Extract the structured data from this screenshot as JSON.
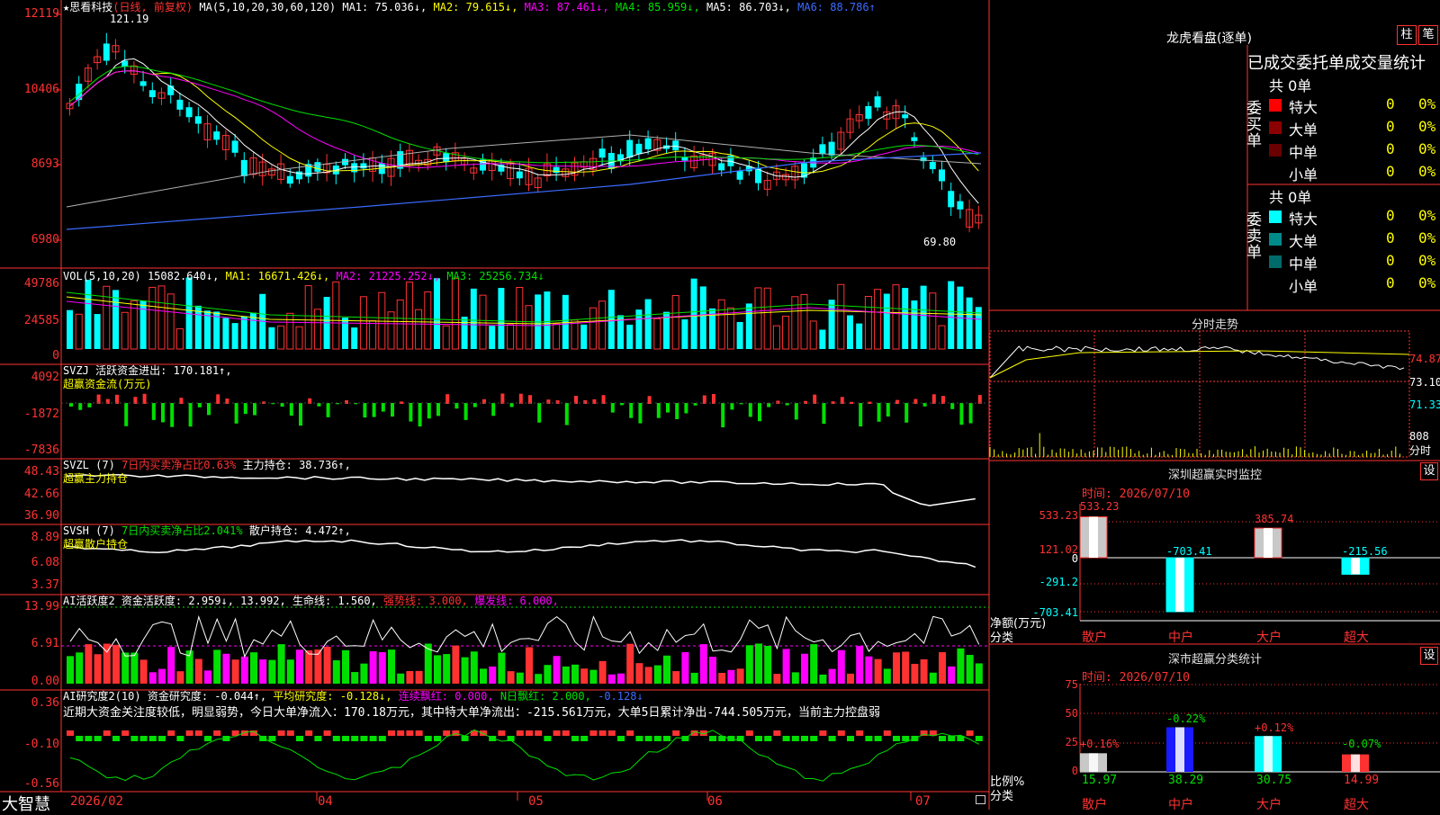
{
  "main_header": {
    "star": "★",
    "stock_name": "思看科技",
    "period": "(日线, 前复权)",
    "ma_label": "MA(5,10,20,30,60,120)",
    "ma1": "MA1: 75.036↓,",
    "ma2": "MA2: 79.615↓,",
    "ma3": "MA3: 87.461↓,",
    "ma4": "MA4: 85.959↓,",
    "ma5": "MA5: 86.703↓,",
    "ma6": "MA6: 88.786↑"
  },
  "price_axis": [
    "12119",
    "10406",
    "8693",
    "6980"
  ],
  "price_annotations": {
    "high": "121.19",
    "low": "69.80"
  },
  "vol_header": {
    "label": "VOL(5,10,20)",
    "value": "15082.640↓,",
    "ma1": "MA1: 16671.426↓,",
    "ma2": "MA2: 21225.252↓,",
    "ma3": "MA3: 25256.734↓"
  },
  "vol_axis": [
    "49786",
    "24585",
    "0"
  ],
  "svzj_header": {
    "label": "SVZJ",
    "text": "活跃资金进出: 170.181↑,",
    "subtitle": "超赢资金流(万元)"
  },
  "svzj_axis": [
    "4092",
    "-1872",
    "-7836"
  ],
  "svzl_header": {
    "label": "SVZL (7)",
    "ratio": "7日内买卖净占比0.63%",
    "text": "主力持仓: 38.736↑,",
    "subtitle": "超赢主力持仓"
  },
  "svzl_axis": [
    "48.43",
    "42.66",
    "36.90"
  ],
  "svsh_header": {
    "label": "SVSH (7)",
    "ratio": "7日内买卖净占比2.041%",
    "text": "散户持仓: 4.472↑,",
    "subtitle": "超赢散户持仓"
  },
  "svsh_axis": [
    "8.89",
    "6.08",
    "3.37"
  ],
  "ai1_header": {
    "label": "AI活跃度2",
    "text": "资金活跃度: 2.959↓, 13.992,",
    "life": "生命线: 1.560,",
    "strong": "强势线: 3.000,",
    "burst": "爆发线: 6.000,"
  },
  "ai1_axis": [
    "13.99",
    "6.91",
    "0.00"
  ],
  "ai2_header": {
    "label": "AI研究度2(10)",
    "text": "资金研究度: -0.044↑,",
    "avg": "平均研究度: -0.128↓,",
    "red": "连续飘红: 0.000,",
    "nred": "N日飘红: 2.000,",
    "blue": "-0.128↓",
    "comment": "近期大资金关注度较低，明显弱势，今日大单净流入：170.18万元，其中特大单净流出：-215.561万元，大单5日累计净出-744.505万元，当前主力控盘弱"
  },
  "ai2_axis": [
    "0.36",
    "-0.10",
    "-0.56"
  ],
  "date_axis": {
    "brand": "大智慧",
    "labels": [
      "2026/02",
      "04",
      "05",
      "06",
      "07"
    ]
  },
  "right_panel": {
    "lhb_title": "龙虎看盘(逐单)",
    "tab1": "柱",
    "tab2": "笔",
    "stats_title": "已成交委托单成交量统计",
    "buy_label": "委买单",
    "sell_label": "委卖单",
    "buy_total": "共 0单",
    "sell_total": "共 0单",
    "buy_rows": [
      {
        "name": "特大",
        "count": "0",
        "pct": "0%",
        "color": "#ff0000"
      },
      {
        "name": "大单",
        "count": "0",
        "pct": "0%",
        "color": "#8b0000"
      },
      {
        "name": "中单",
        "count": "0",
        "pct": "0%",
        "color": "#6a0000"
      },
      {
        "name": "小单",
        "count": "0",
        "pct": "0%",
        "color": "#000000"
      }
    ],
    "sell_rows": [
      {
        "name": "特大",
        "count": "0",
        "pct": "0%",
        "color": "#00ffff"
      },
      {
        "name": "大单",
        "count": "0",
        "pct": "0%",
        "color": "#008b8b"
      },
      {
        "name": "中单",
        "count": "0",
        "pct": "0%",
        "color": "#006a6a"
      },
      {
        "name": "小单",
        "count": "0",
        "pct": "0%",
        "color": "#000000"
      }
    ],
    "intraday_title": "分时走势",
    "intraday_axis": [
      "74.87",
      "73.10",
      "71.33",
      "808",
      "分时"
    ],
    "sz_monitor_title": "深圳超赢实时监控",
    "sz_setting": "设",
    "sz_time": "时间: 2026/07/10",
    "sz_axis": [
      "533.23",
      "121.02",
      "0",
      "-291.2",
      "-703.41"
    ],
    "sz_values": [
      "533.23",
      "-703.41",
      "385.74",
      "-215.56"
    ],
    "sz_ylabel": "净额(万元)",
    "sz_xlabel": "分类",
    "categories": [
      "散户",
      "中户",
      "大户",
      "超大"
    ],
    "cls_title": "深市超赢分类统计",
    "cls_setting": "设",
    "cls_time": "时间: 2026/07/10",
    "cls_axis": [
      "75",
      "50",
      "25",
      "0"
    ],
    "cls_changes": [
      "+0.16%",
      "-0.22%",
      "+0.12%",
      "-0.07%"
    ],
    "cls_values": [
      "15.97",
      "38.29",
      "30.75",
      "14.99"
    ],
    "cls_ylabel": "比例%",
    "cls_xlabel": "分类"
  }
}
